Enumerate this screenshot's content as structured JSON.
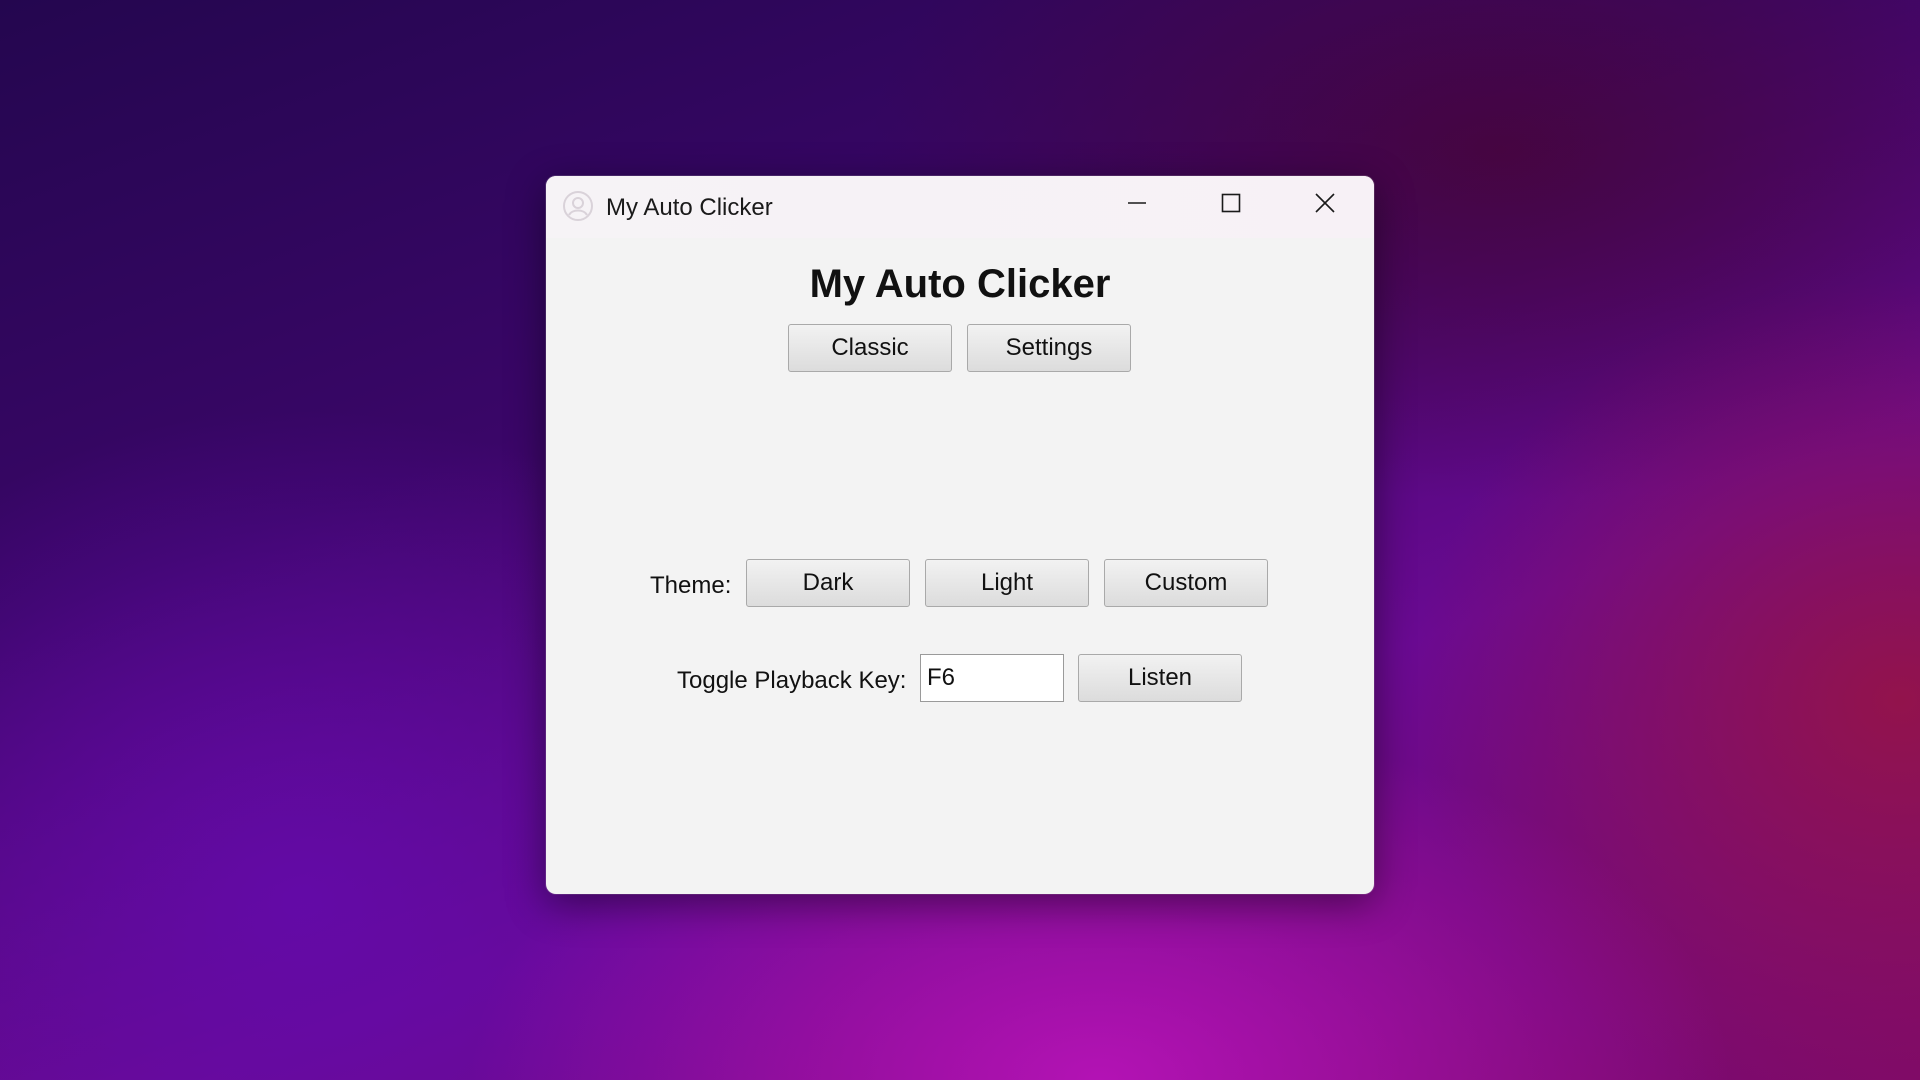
{
  "window": {
    "title": "My Auto Clicker",
    "controls": {
      "minimize_icon": "minimize-icon",
      "maximize_icon": "maximize-icon",
      "close_icon": "close-icon"
    }
  },
  "main": {
    "heading": "My Auto Clicker",
    "tabs": [
      {
        "label": "Classic"
      },
      {
        "label": "Settings"
      }
    ],
    "theme": {
      "label": "Theme:",
      "options": [
        {
          "label": "Dark"
        },
        {
          "label": "Light"
        },
        {
          "label": "Custom"
        }
      ]
    },
    "hotkey": {
      "label": "Toggle Playback Key:",
      "value": "F6",
      "listen_label": "Listen"
    }
  },
  "colors": {
    "window_background": "#f3f3f3",
    "button_border": "#a9a9a9"
  }
}
